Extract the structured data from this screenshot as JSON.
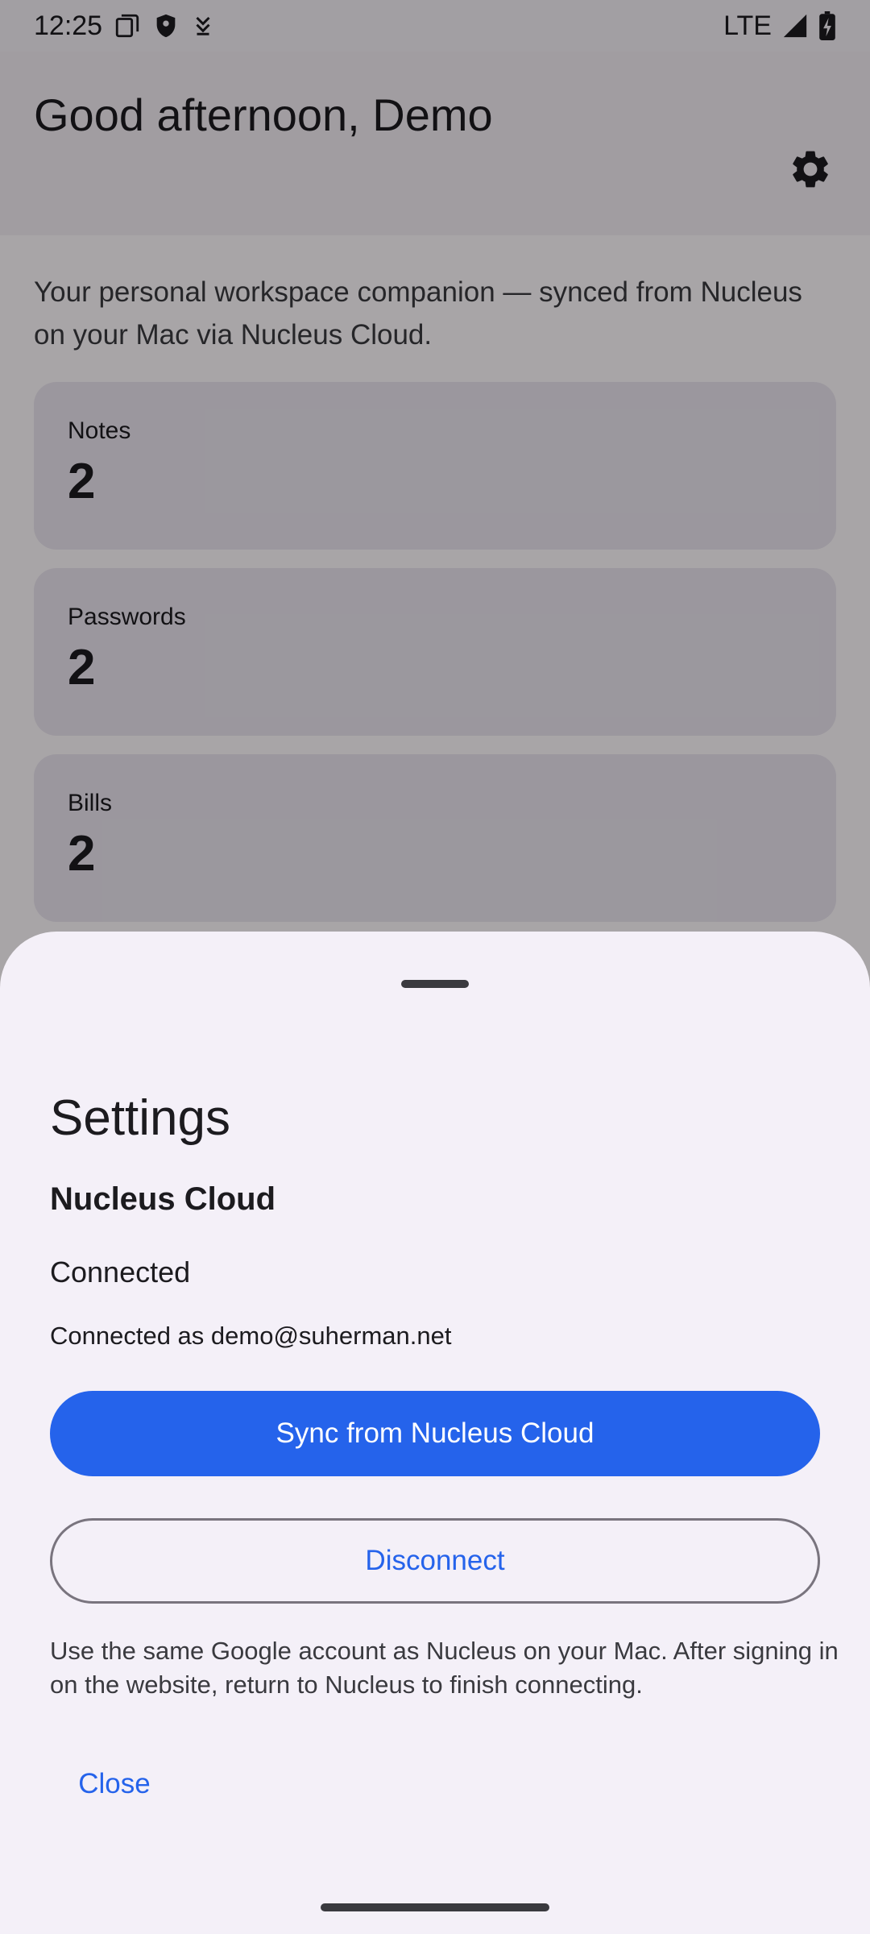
{
  "status_bar": {
    "time": "12:25",
    "network": "LTE"
  },
  "header": {
    "greeting": "Good afternoon, Demo",
    "settings_icon": "gear-icon"
  },
  "intro": "Your personal workspace companion — synced from Nucleus on your Mac via Nucleus Cloud.",
  "cards": [
    {
      "label": "Notes",
      "value": "2"
    },
    {
      "label": "Passwords",
      "value": "2"
    },
    {
      "label": "Bills",
      "value": "2"
    }
  ],
  "settings_sheet": {
    "title": "Settings",
    "section_title": "Nucleus Cloud",
    "status": "Connected",
    "account": "Connected as demo@suherman.net",
    "sync_button": "Sync from Nucleus Cloud",
    "disconnect_button": "Disconnect",
    "help": "Use the same Google account as Nucleus on your Mac. After signing in on the website, return to Nucleus to finish connecting.",
    "close_button": "Close"
  },
  "colors": {
    "accent": "#2563eb",
    "sheet_background": "#f4f0f8",
    "card_background": "#ece6f0"
  }
}
